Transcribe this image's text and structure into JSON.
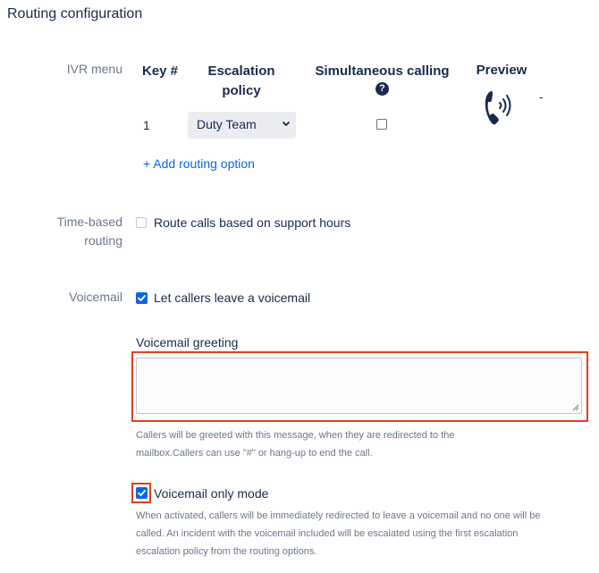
{
  "section_title": "Routing configuration",
  "ivr": {
    "label": "IVR menu",
    "columns": {
      "key": "Key #",
      "escalation": "Escalation policy",
      "simultaneous": "Simultaneous calling",
      "preview": "Preview"
    },
    "rows": [
      {
        "key": "1",
        "escalation_policy": "Duty Team",
        "simultaneous_calling": false
      }
    ],
    "preview_value": "-",
    "add_option_label": "+ Add routing option"
  },
  "time_based": {
    "label": "Time-based routing",
    "checkbox_label": "Route calls based on support hours",
    "checked": false
  },
  "voicemail": {
    "label": "Voicemail",
    "checkbox_label": "Let callers leave a voicemail",
    "checked": true,
    "greeting_label": "Voicemail greeting",
    "greeting_value": "",
    "greeting_help": "Callers will be greeted with this message, when they are redirected to the mailbox.Callers can use \"#\" or hang-up to end the call.",
    "only_mode_label": "Voicemail only mode",
    "only_mode_checked": true,
    "only_mode_help": "When activated, callers will be immediately redirected to leave a voicemail and no one will be called. An incident with the voicemail included will be escalated using the first escalation escalation policy from the routing options."
  },
  "colors": {
    "accent": "#0c66e4",
    "highlight": "#e0401c",
    "label": "#6b778c",
    "text": "#172b4d"
  },
  "icons": {
    "help": "question-circle-icon",
    "preview": "phone-ringing-icon",
    "select": "chevron-down-icon",
    "check": "checkmark-icon"
  }
}
